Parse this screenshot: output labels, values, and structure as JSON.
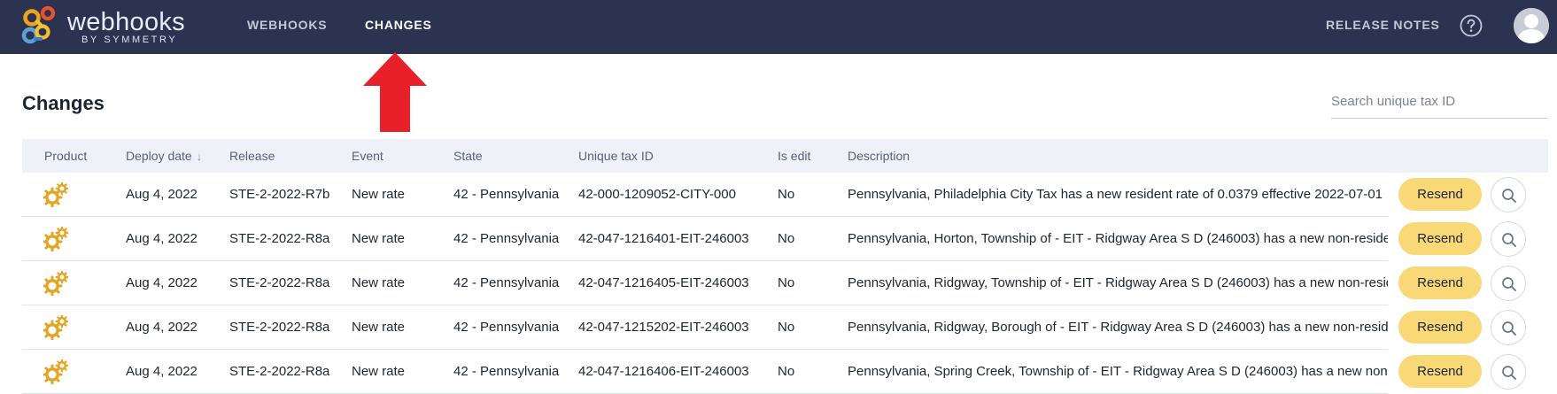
{
  "app": {
    "name": "webhooks",
    "subtitle": "BY SYMMETRY"
  },
  "nav": {
    "items": [
      {
        "label": "WEBHOOKS",
        "active": false
      },
      {
        "label": "CHANGES",
        "active": true
      }
    ],
    "release_notes": "RELEASE NOTES",
    "help_icon": "question-circle-icon",
    "avatar_icon": "user-avatar-icon"
  },
  "annotation": {
    "arrow_color": "#e8202a",
    "points_to": "CHANGES"
  },
  "page": {
    "title": "Changes",
    "search_placeholder": "Search unique tax ID"
  },
  "table": {
    "columns": [
      "Product",
      "Deploy date",
      "Release",
      "Event",
      "State",
      "Unique tax ID",
      "Is edit",
      "Description"
    ],
    "sort_column": "Deploy date",
    "sort_icon": "arrow-down-icon",
    "rows": [
      {
        "product_icon": "gears-icon",
        "deploy_date": "Aug 4, 2022",
        "release": "STE-2-2022-R7b",
        "event": "New rate",
        "state": "42 - Pennsylvania",
        "tax_id": "42-000-1209052-CITY-000",
        "is_edit": "No",
        "description": "Pennsylvania, Philadelphia City Tax has a new resident rate of 0.0379 effective 2022-07-01",
        "resend_label": "Resend"
      },
      {
        "product_icon": "gears-icon",
        "deploy_date": "Aug 4, 2022",
        "release": "STE-2-2022-R8a",
        "event": "New rate",
        "state": "42 - Pennsylvania",
        "tax_id": "42-047-1216401-EIT-246003",
        "is_edit": "No",
        "description": "Pennsylvania, Horton, Township of - EIT - Ridgway Area S D (246003) has a new non-resident",
        "resend_label": "Resend"
      },
      {
        "product_icon": "gears-icon",
        "deploy_date": "Aug 4, 2022",
        "release": "STE-2-2022-R8a",
        "event": "New rate",
        "state": "42 - Pennsylvania",
        "tax_id": "42-047-1216405-EIT-246003",
        "is_edit": "No",
        "description": "Pennsylvania, Ridgway, Township of - EIT - Ridgway Area S D (246003) has a new non-resident",
        "resend_label": "Resend"
      },
      {
        "product_icon": "gears-icon",
        "deploy_date": "Aug 4, 2022",
        "release": "STE-2-2022-R8a",
        "event": "New rate",
        "state": "42 - Pennsylvania",
        "tax_id": "42-047-1215202-EIT-246003",
        "is_edit": "No",
        "description": "Pennsylvania, Ridgway, Borough of - EIT - Ridgway Area S D (246003) has a new non-resident",
        "resend_label": "Resend"
      },
      {
        "product_icon": "gears-icon",
        "deploy_date": "Aug 4, 2022",
        "release": "STE-2-2022-R8a",
        "event": "New rate",
        "state": "42 - Pennsylvania",
        "tax_id": "42-047-1216406-EIT-246003",
        "is_edit": "No",
        "description": "Pennsylvania, Spring Creek, Township of - EIT - Ridgway Area S D (246003) has a new non-resident",
        "resend_label": "Resend"
      }
    ],
    "view_icon": "magnifier-icon"
  },
  "colors": {
    "topbar": "#2b3350",
    "resend_button": "#f8d877",
    "product_icon": "#e5a421",
    "header_bg": "#eef1f7"
  }
}
